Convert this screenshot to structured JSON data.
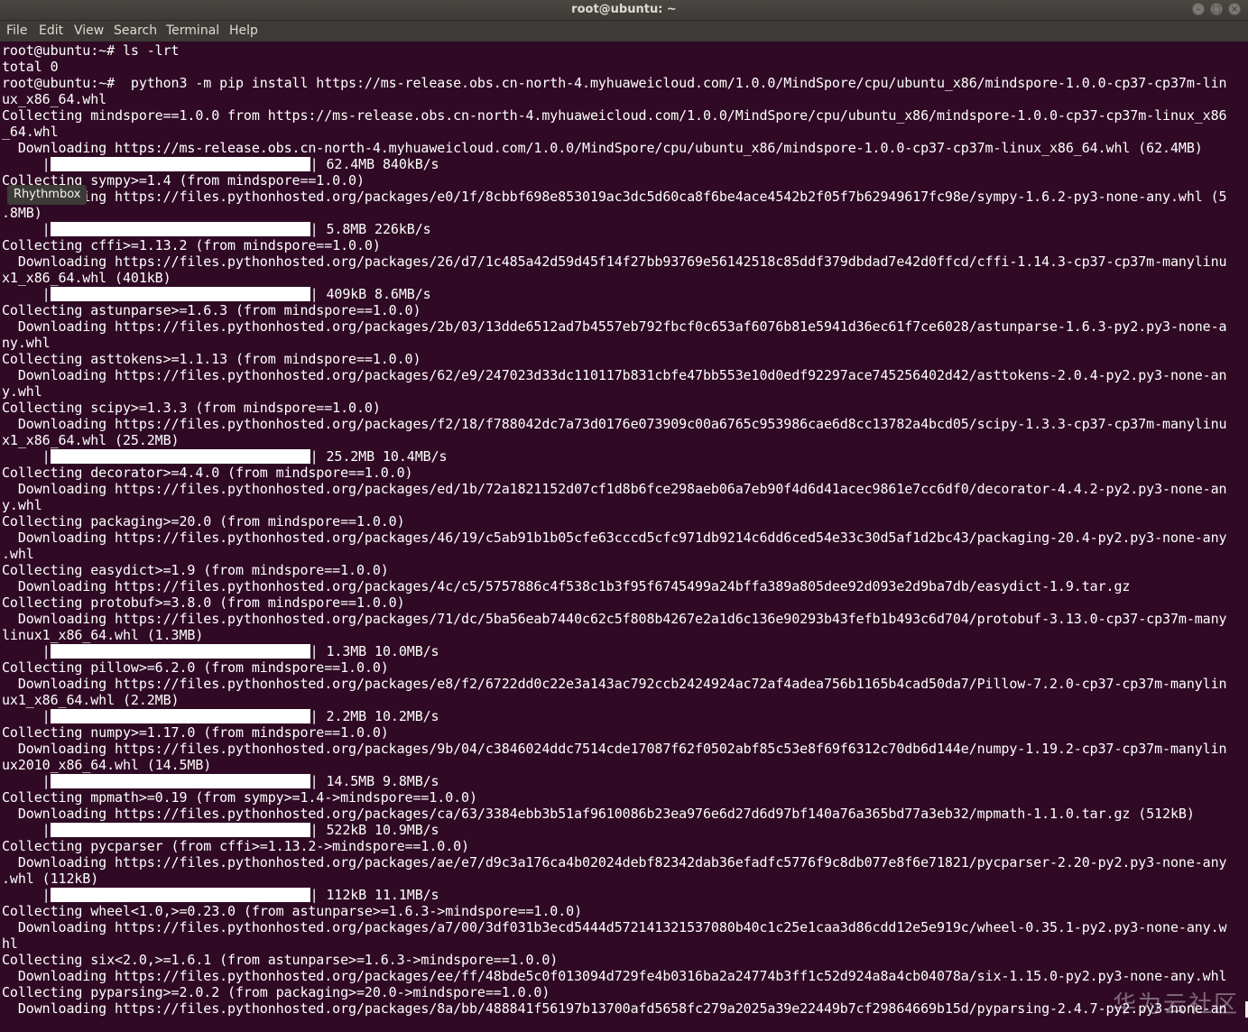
{
  "window": {
    "title": "root@ubuntu: ~"
  },
  "menu": [
    "File",
    "Edit",
    "View",
    "Search",
    "Terminal",
    "Help"
  ],
  "tooltip": "Rhythmbox",
  "watermark": "华为云社区",
  "lines": [
    "root@ubuntu:~# ls -lrt",
    "total 0",
    "root@ubuntu:~#  python3 -m pip install https://ms-release.obs.cn-north-4.myhuaweicloud.com/1.0.0/MindSpore/cpu/ubuntu_x86/mindspore-1.0.0-cp37-cp37m-lin",
    "ux_x86_64.whl",
    "Collecting mindspore==1.0.0 from https://ms-release.obs.cn-north-4.myhuaweicloud.com/1.0.0/MindSpore/cpu/ubuntu_x86/mindspore-1.0.0-cp37-cp37m-linux_x86",
    "_64.whl",
    "  Downloading https://ms-release.obs.cn-north-4.myhuaweicloud.com/1.0.0/MindSpore/cpu/ubuntu_x86/mindspore-1.0.0-cp37-cp37m-linux_x86_64.whl (62.4MB)",
    "PROGRESS:62.4MB 840kB/s",
    "Collecting sympy>=1.4 (from mindspore==1.0.0)",
    "  Downloading https://files.pythonhosted.org/packages/e0/1f/8cbbf698e853019ac3dc5d60ca8f6be4ace4542b2f05f7b62949617fc98e/sympy-1.6.2-py3-none-any.whl (5",
    ".8MB)",
    "PROGRESS:5.8MB 226kB/s",
    "Collecting cffi>=1.13.2 (from mindspore==1.0.0)",
    "  Downloading https://files.pythonhosted.org/packages/26/d7/1c485a42d59d45f14f27bb93769e56142518c85ddf379dbdad7e42d0ffcd/cffi-1.14.3-cp37-cp37m-manylinu",
    "x1_x86_64.whl (401kB)",
    "PROGRESS:409kB 8.6MB/s",
    "Collecting astunparse>=1.6.3 (from mindspore==1.0.0)",
    "  Downloading https://files.pythonhosted.org/packages/2b/03/13dde6512ad7b4557eb792fbcf0c653af6076b81e5941d36ec61f7ce6028/astunparse-1.6.3-py2.py3-none-a",
    "ny.whl",
    "Collecting asttokens>=1.1.13 (from mindspore==1.0.0)",
    "  Downloading https://files.pythonhosted.org/packages/62/e9/247023d33dc110117b831cbfe47bb553e10d0edf92297ace745256402d42/asttokens-2.0.4-py2.py3-none-an",
    "y.whl",
    "Collecting scipy>=1.3.3 (from mindspore==1.0.0)",
    "  Downloading https://files.pythonhosted.org/packages/f2/18/f788042dc7a73d0176e073909c00a6765c953986cae6d8cc13782a4bcd05/scipy-1.3.3-cp37-cp37m-manylinu",
    "x1_x86_64.whl (25.2MB)",
    "PROGRESS:25.2MB 10.4MB/s",
    "Collecting decorator>=4.4.0 (from mindspore==1.0.0)",
    "  Downloading https://files.pythonhosted.org/packages/ed/1b/72a1821152d07cf1d8b6fce298aeb06a7eb90f4d6d41acec9861e7cc6df0/decorator-4.4.2-py2.py3-none-an",
    "y.whl",
    "Collecting packaging>=20.0 (from mindspore==1.0.0)",
    "  Downloading https://files.pythonhosted.org/packages/46/19/c5ab91b1b05cfe63cccd5cfc971db9214c6dd6ced54e33c30d5af1d2bc43/packaging-20.4-py2.py3-none-any",
    ".whl",
    "Collecting easydict>=1.9 (from mindspore==1.0.0)",
    "  Downloading https://files.pythonhosted.org/packages/4c/c5/5757886c4f538c1b3f95f6745499a24bffa389a805dee92d093e2d9ba7db/easydict-1.9.tar.gz",
    "Collecting protobuf>=3.8.0 (from mindspore==1.0.0)",
    "  Downloading https://files.pythonhosted.org/packages/71/dc/5ba56eab7440c62c5f808b4267e2a1d6c136e90293b43fefb1b493c6d704/protobuf-3.13.0-cp37-cp37m-many",
    "linux1_x86_64.whl (1.3MB)",
    "PROGRESS:1.3MB 10.0MB/s",
    "Collecting pillow>=6.2.0 (from mindspore==1.0.0)",
    "  Downloading https://files.pythonhosted.org/packages/e8/f2/6722dd0c22e3a143ac792ccb2424924ac72af4adea756b1165b4cad50da7/Pillow-7.2.0-cp37-cp37m-manylin",
    "ux1_x86_64.whl (2.2MB)",
    "PROGRESS:2.2MB 10.2MB/s",
    "Collecting numpy>=1.17.0 (from mindspore==1.0.0)",
    "  Downloading https://files.pythonhosted.org/packages/9b/04/c3846024ddc7514cde17087f62f0502abf85c53e8f69f6312c70db6d144e/numpy-1.19.2-cp37-cp37m-manylin",
    "ux2010_x86_64.whl (14.5MB)",
    "PROGRESS:14.5MB 9.8MB/s",
    "Collecting mpmath>=0.19 (from sympy>=1.4->mindspore==1.0.0)",
    "  Downloading https://files.pythonhosted.org/packages/ca/63/3384ebb3b51af9610086b23ea976e6d27d6d97bf140a76a365bd77a3eb32/mpmath-1.1.0.tar.gz (512kB)",
    "PROGRESS:522kB 10.9MB/s",
    "Collecting pycparser (from cffi>=1.13.2->mindspore==1.0.0)",
    "  Downloading https://files.pythonhosted.org/packages/ae/e7/d9c3a176ca4b02024debf82342dab36efadfc5776f9c8db077e8f6e71821/pycparser-2.20-py2.py3-none-any",
    ".whl (112kB)",
    "PROGRESS:112kB 11.1MB/s",
    "Collecting wheel<1.0,>=0.23.0 (from astunparse>=1.6.3->mindspore==1.0.0)",
    "  Downloading https://files.pythonhosted.org/packages/a7/00/3df031b3ecd5444d572141321537080b40c1c25e1caa3d86cdd12e5e919c/wheel-0.35.1-py2.py3-none-any.w",
    "hl",
    "Collecting six<2.0,>=1.6.1 (from astunparse>=1.6.3->mindspore==1.0.0)",
    "  Downloading https://files.pythonhosted.org/packages/ee/ff/48bde5c0f013094d729fe4b0316ba2a24774b3ff1c52d924a8a4cb04078a/six-1.15.0-py2.py3-none-any.whl",
    "Collecting pyparsing>=2.0.2 (from packaging>=20.0->mindspore==1.0.0)",
    "  Downloading https://files.pythonhosted.org/packages/8a/bb/488841f56197b13700afd5658fc279a2025a39e22449b7cf29864669b15d/pyparsing-2.4.7-py2.py3-none-an"
  ]
}
